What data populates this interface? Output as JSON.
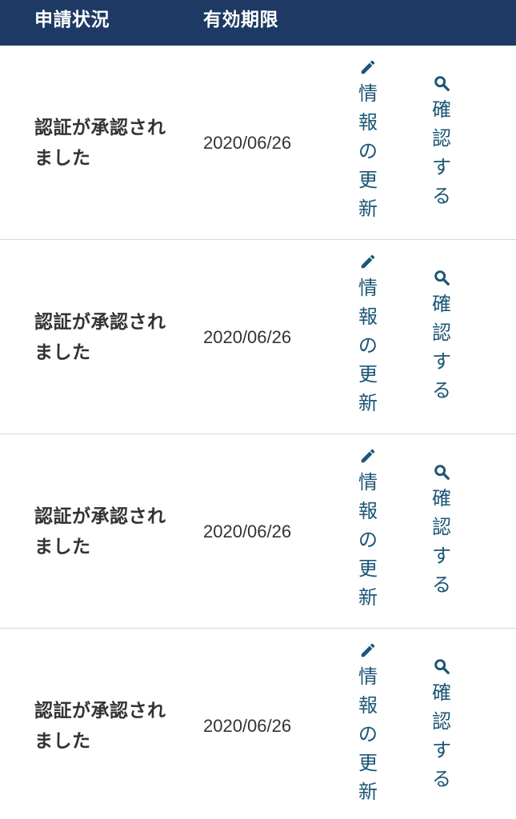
{
  "header": {
    "status_label": "申請状況",
    "expiry_label": "有効期限"
  },
  "rows": [
    {
      "status": "認証が承認されました",
      "expiry": "2020/06/26",
      "update_label": "情報の更新",
      "confirm_label": "確認する"
    },
    {
      "status": "認証が承認されました",
      "expiry": "2020/06/26",
      "update_label": "情報の更新",
      "confirm_label": "確認する"
    },
    {
      "status": "認証が承認されました",
      "expiry": "2020/06/26",
      "update_label": "情報の更新",
      "confirm_label": "確認する"
    },
    {
      "status": "認証が承認されました",
      "expiry": "2020/06/26",
      "update_label": "情報の更新",
      "confirm_label": "確認する"
    }
  ],
  "icons": {
    "update": "pencil-icon",
    "confirm": "search-icon"
  },
  "colors": {
    "header_bg": "#1e3a64",
    "link": "#1b5676",
    "text": "#333333",
    "divider": "#d9d9d9"
  }
}
